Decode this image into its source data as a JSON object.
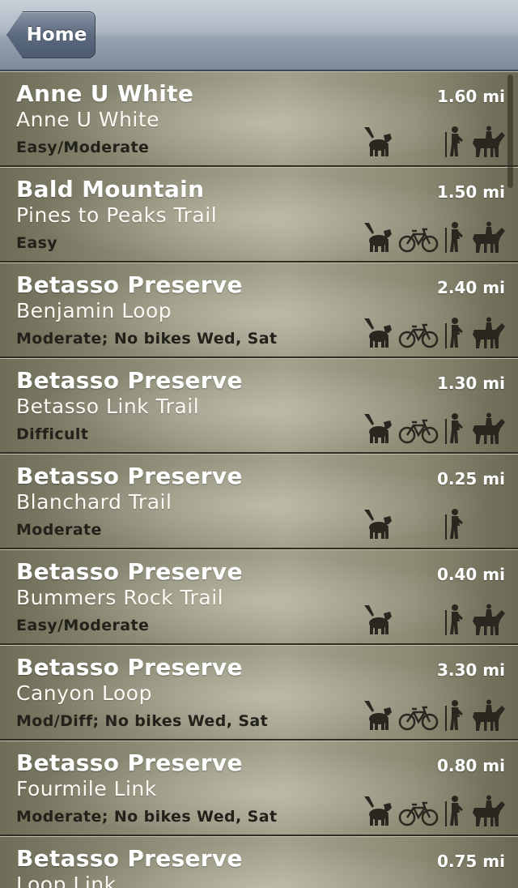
{
  "nav": {
    "back_label": "Home"
  },
  "colors": {
    "row_base": "#94937d",
    "difficulty_text": "#22221a",
    "nav_bar": "#aeb7c3"
  },
  "trails": [
    {
      "title": "Anne U White",
      "subtitle": "Anne U White",
      "difficulty": "Easy/Moderate",
      "distance": "1.60 mi",
      "icons": {
        "dog": true,
        "bike": false,
        "hike": true,
        "horse": true
      }
    },
    {
      "title": "Bald Mountain",
      "subtitle": "Pines to Peaks Trail",
      "difficulty": "Easy",
      "distance": "1.50 mi",
      "icons": {
        "dog": true,
        "bike": true,
        "hike": true,
        "horse": true
      }
    },
    {
      "title": "Betasso Preserve",
      "subtitle": "Benjamin Loop",
      "difficulty": "Moderate; No bikes Wed, Sat",
      "distance": "2.40 mi",
      "icons": {
        "dog": true,
        "bike": true,
        "hike": true,
        "horse": true
      }
    },
    {
      "title": "Betasso Preserve",
      "subtitle": "Betasso Link Trail",
      "difficulty": "Difficult",
      "distance": "1.30 mi",
      "icons": {
        "dog": true,
        "bike": true,
        "hike": true,
        "horse": true
      }
    },
    {
      "title": "Betasso Preserve",
      "subtitle": "Blanchard Trail",
      "difficulty": "Moderate",
      "distance": "0.25 mi",
      "icons": {
        "dog": true,
        "bike": false,
        "hike": true,
        "horse": false
      }
    },
    {
      "title": "Betasso Preserve",
      "subtitle": "Bummers Rock Trail",
      "difficulty": "Easy/Moderate",
      "distance": "0.40 mi",
      "icons": {
        "dog": true,
        "bike": false,
        "hike": true,
        "horse": true
      }
    },
    {
      "title": "Betasso Preserve",
      "subtitle": "Canyon Loop",
      "difficulty": "Mod/Diff; No bikes Wed, Sat",
      "distance": "3.30 mi",
      "icons": {
        "dog": true,
        "bike": true,
        "hike": true,
        "horse": true
      }
    },
    {
      "title": "Betasso Preserve",
      "subtitle": "Fourmile Link",
      "difficulty": "Moderate; No bikes Wed, Sat",
      "distance": "0.80 mi",
      "icons": {
        "dog": true,
        "bike": true,
        "hike": true,
        "horse": true
      }
    },
    {
      "title": "Betasso Preserve",
      "subtitle": "Loop Link",
      "difficulty": "",
      "distance": "0.75 mi",
      "icons": {
        "dog": false,
        "bike": false,
        "hike": false,
        "horse": false
      }
    }
  ]
}
